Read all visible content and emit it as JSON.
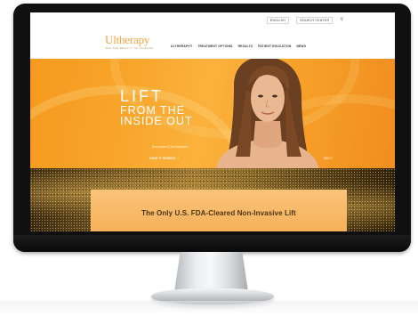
{
  "header": {
    "utility_nav": [
      "ENGLISH",
      "SEARCH CENTER",
      "Q"
    ],
    "logo_text": "Ultherapy",
    "logo_tagline": "SEE THE BEAUTY OF SCIENCE",
    "main_nav": [
      "ULTHERAPY®",
      "TREATMENT OPTIONS",
      "RESULTS",
      "PATIENT EDUCATION",
      "NEWS"
    ]
  },
  "hero": {
    "title_line1": "LIFT",
    "title_line2": "FROM THE",
    "title_line3": "INSIDE OUT",
    "subtitle": "Non-Invasive | No Downtime",
    "cta": "HOW IT WORKS",
    "cta_icon": "arrow-right-icon",
    "right_link": "SEE IT"
  },
  "banner": {
    "headline": "The Only U.S. FDA-Cleared Non-Invasive Lift"
  },
  "colors": {
    "brand_orange": "#f8a42a",
    "logo": "#f0a43a",
    "bezel": "#101010",
    "banner_text": "#4a3514"
  }
}
